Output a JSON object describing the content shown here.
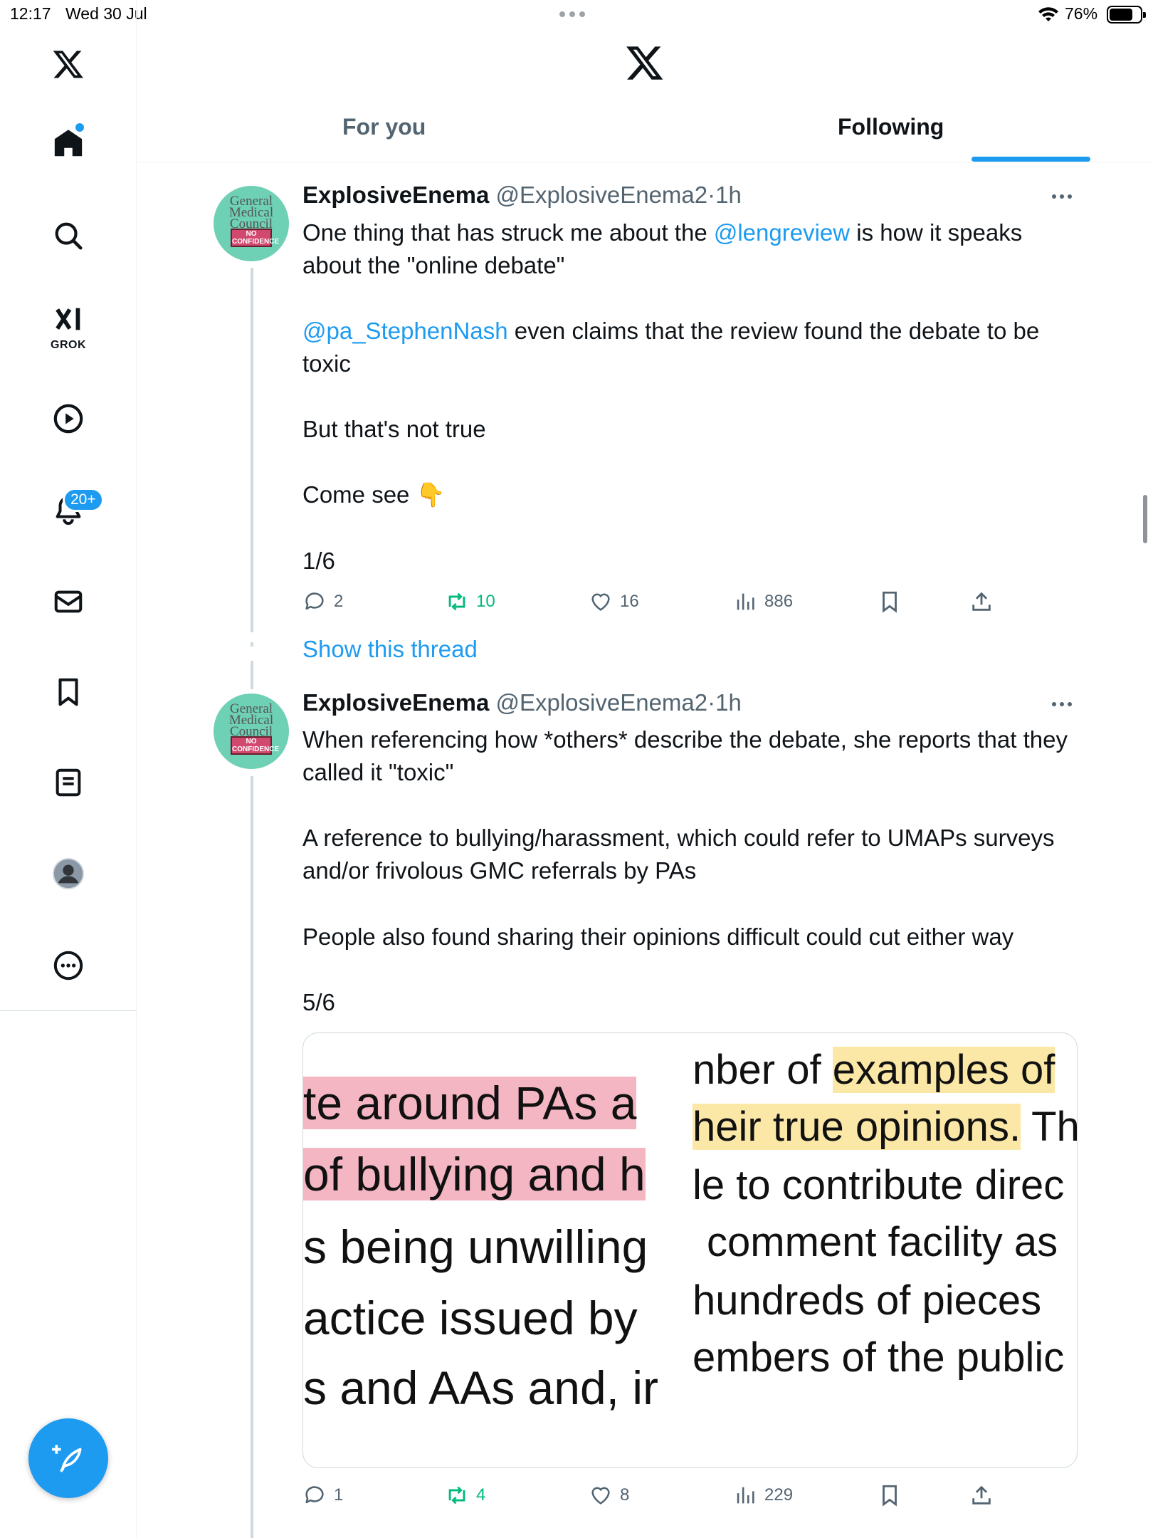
{
  "status_bar": {
    "time": "12:17",
    "date": "Wed 30 Jul",
    "battery": "76%",
    "battery_level": 0.76
  },
  "sidebar": {
    "items": [
      {
        "name": "home",
        "label": "Home"
      },
      {
        "name": "explore",
        "label": "Explore"
      },
      {
        "name": "grok",
        "label": "GROK"
      },
      {
        "name": "video",
        "label": "Video"
      },
      {
        "name": "notifications",
        "label": "Notifications",
        "badge": "20+"
      },
      {
        "name": "messages",
        "label": "Messages"
      },
      {
        "name": "bookmarks",
        "label": "Bookmarks"
      },
      {
        "name": "lists",
        "label": "Lists"
      },
      {
        "name": "profile",
        "label": "Profile"
      },
      {
        "name": "more",
        "label": "More"
      }
    ]
  },
  "tabs": [
    {
      "label": "For you",
      "active": false
    },
    {
      "label": "Following",
      "active": true
    }
  ],
  "tweets": [
    {
      "name": "ExplosiveEnema",
      "handle": "@ExplosiveEnema2",
      "sep": "·",
      "time": "1h",
      "text_parts": {
        "p1_a": "One thing that has struck me about the ",
        "p1_mention": "@lengreview",
        "p1_b": " is how it speaks about the \"online debate\"",
        "p2_mention": "@pa_StephenNash",
        "p2_b": " even claims that the review found the debate to be toxic",
        "p3": "But that's not true",
        "p4": "Come see",
        "p4_emoji": "👇",
        "p5": "1/6"
      },
      "stats": {
        "replies": "2",
        "reposts": "10",
        "likes": "16",
        "views": "886"
      },
      "show_thread": "Show this thread"
    },
    {
      "name": "ExplosiveEnema",
      "handle": "@ExplosiveEnema2",
      "sep": "·",
      "time": "1h",
      "text_parts": {
        "p1": "When referencing how *others* describe the debate, she reports that they called it \"toxic\"",
        "p2": "A reference to bullying/harassment, which could refer to UMAPs surveys and/or frivolous GMC referrals by PAs",
        "p3": "People also found sharing their opinions difficult could cut either way",
        "p4": "5/6"
      },
      "media": {
        "left_lines": [
          "te around PAs a",
          "of bullying and h",
          "s being unwilling",
          "actice issued by",
          "s and AAs and, ir"
        ],
        "right_lines": [
          "nber of ",
          "examples of",
          "heir true opinions.",
          " Th",
          "le to contribute direc",
          "comment facility as",
          "hundreds of pieces",
          "embers of the public"
        ]
      },
      "stats": {
        "replies": "1",
        "reposts": "4",
        "likes": "8",
        "views": "229"
      }
    }
  ],
  "avatar_text": {
    "line1": "General",
    "line2": "Medical",
    "line3": "Council",
    "stamp": "NO CONFIDENCE"
  },
  "colors": {
    "accent": "#1d9bf0",
    "repost": "#00ba7c",
    "secondary": "#536471"
  }
}
